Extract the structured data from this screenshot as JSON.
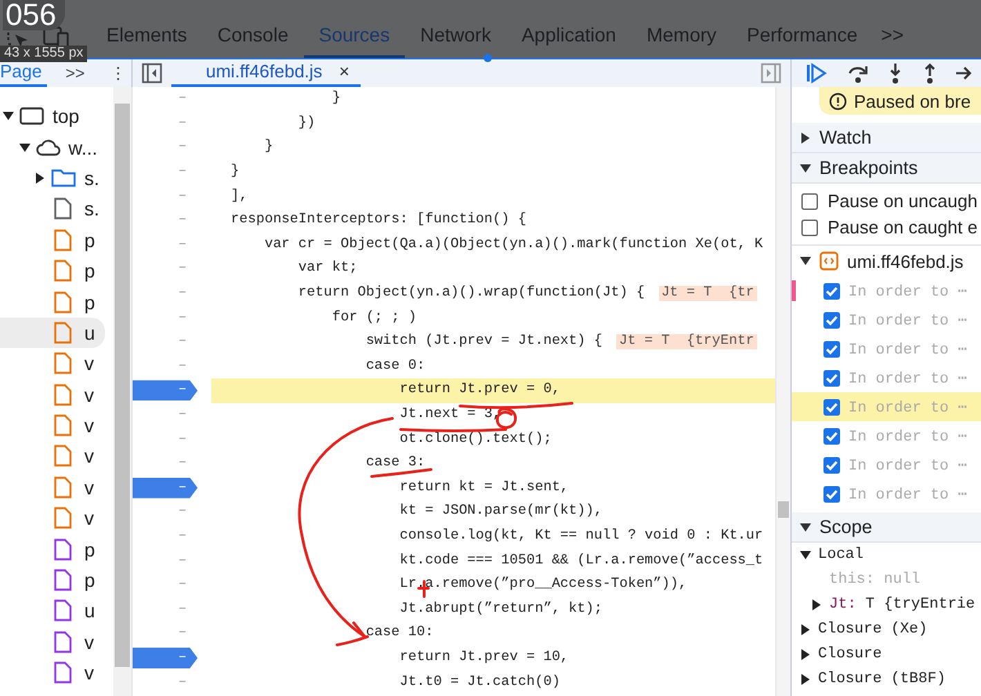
{
  "top_badge": "056",
  "dimension_tooltip": "43 x 1555 px",
  "panel_tabs": [
    {
      "label": "Elements",
      "selected": false
    },
    {
      "label": "Console",
      "selected": false
    },
    {
      "label": "Sources",
      "selected": true
    },
    {
      "label": "Network",
      "selected": false
    },
    {
      "label": "Application",
      "selected": false
    },
    {
      "label": "Memory",
      "selected": false
    },
    {
      "label": "Performance",
      "selected": false
    }
  ],
  "more_tabs": ">>",
  "navigator": {
    "tab": "Page",
    "more": ">>",
    "menu": "⋮"
  },
  "file_tree": [
    {
      "label": "top",
      "kind": "frame",
      "expanded": true,
      "selected": false,
      "children": [
        {
          "label": "w...",
          "kind": "cloud",
          "expanded": true,
          "selected": false,
          "children": [
            {
              "label": "s.",
              "kind": "folder",
              "expanded": false,
              "selected": false
            },
            {
              "label": "s.",
              "kind": "file",
              "color": "#5f6368",
              "selected": false
            },
            {
              "label": "p",
              "kind": "file",
              "color": "#e8710a",
              "selected": false
            },
            {
              "label": "p",
              "kind": "file",
              "color": "#e8710a",
              "selected": false
            },
            {
              "label": "p",
              "kind": "file",
              "color": "#e8710a",
              "selected": false
            },
            {
              "label": "u",
              "kind": "file",
              "color": "#e8710a",
              "selected": true
            },
            {
              "label": "v",
              "kind": "file",
              "color": "#e8710a",
              "selected": false
            },
            {
              "label": "v",
              "kind": "file",
              "color": "#e8710a",
              "selected": false
            },
            {
              "label": "v",
              "kind": "file",
              "color": "#e8710a",
              "selected": false
            },
            {
              "label": "v",
              "kind": "file",
              "color": "#e8710a",
              "selected": false
            },
            {
              "label": "v",
              "kind": "file",
              "color": "#e8710a",
              "selected": false
            },
            {
              "label": "v",
              "kind": "file",
              "color": "#e8710a",
              "selected": false
            },
            {
              "label": "p",
              "kind": "file",
              "color": "#9334e6",
              "selected": false
            },
            {
              "label": "p",
              "kind": "file",
              "color": "#9334e6",
              "selected": false
            },
            {
              "label": "u",
              "kind": "file",
              "color": "#9334e6",
              "selected": false
            },
            {
              "label": "v",
              "kind": "file",
              "color": "#9334e6",
              "selected": false
            },
            {
              "label": "v",
              "kind": "file",
              "color": "#9334e6",
              "selected": false
            }
          ]
        }
      ]
    }
  ],
  "editor": {
    "file_tab": {
      "label": "umi.ff46febd.js",
      "close": "×"
    },
    "lines": [
      {
        "number": "–",
        "breakpoint": false,
        "current": false,
        "code": "            }"
      },
      {
        "number": "–",
        "breakpoint": false,
        "current": false,
        "code": "        })"
      },
      {
        "number": "–",
        "breakpoint": false,
        "current": false,
        "code": "    }"
      },
      {
        "number": "–",
        "breakpoint": false,
        "current": false,
        "code": "}"
      },
      {
        "number": "–",
        "breakpoint": false,
        "current": false,
        "code": "],"
      },
      {
        "number": "–",
        "breakpoint": false,
        "current": false,
        "code": "responseInterceptors: [function() {"
      },
      {
        "number": "–",
        "breakpoint": false,
        "current": false,
        "code": "    var cr = Object(Qa.a)(Object(yn.a)().mark(function Xe(ot, K"
      },
      {
        "number": "–",
        "breakpoint": false,
        "current": false,
        "code": "        var kt;"
      },
      {
        "number": "–",
        "breakpoint": false,
        "current": false,
        "code": "        return Object(yn.a)().wrap(function(Jt) {",
        "inline_value": "Jt = T  {tr"
      },
      {
        "number": "–",
        "breakpoint": false,
        "current": false,
        "code": "            for (; ; )"
      },
      {
        "number": "–",
        "breakpoint": false,
        "current": false,
        "code": "                switch (Jt.prev = Jt.next) {",
        "inline_value": "Jt = T  {tryEntr"
      },
      {
        "number": "–",
        "breakpoint": false,
        "current": false,
        "code": "                case 0:"
      },
      {
        "number": "–",
        "breakpoint": true,
        "current": true,
        "code": "                    return Jt.prev = 0,"
      },
      {
        "number": "–",
        "breakpoint": false,
        "current": false,
        "code": "                    Jt.next = 3,"
      },
      {
        "number": "–",
        "breakpoint": false,
        "current": false,
        "code": "                    ot.clone().text();"
      },
      {
        "number": "–",
        "breakpoint": false,
        "current": false,
        "code": "                case 3:"
      },
      {
        "number": "–",
        "breakpoint": true,
        "current": false,
        "code": "                    return kt = Jt.sent,"
      },
      {
        "number": "–",
        "breakpoint": false,
        "current": false,
        "code": "                    kt = JSON.parse(mr(kt)),"
      },
      {
        "number": "–",
        "breakpoint": false,
        "current": false,
        "code": "                    console.log(kt, Kt == null ? void 0 : Kt.ur"
      },
      {
        "number": "–",
        "breakpoint": false,
        "current": false,
        "code": "                    kt.code === 10501 && (Lr.a.remove(”access_t"
      },
      {
        "number": "–",
        "breakpoint": false,
        "current": false,
        "code": "                    Lr.a.remove(”pro__Access-Token”)),"
      },
      {
        "number": "–",
        "breakpoint": false,
        "current": false,
        "code": "                    Jt.abrupt(”return”, kt);"
      },
      {
        "number": "–",
        "breakpoint": false,
        "current": false,
        "code": "                case 10:"
      },
      {
        "number": "–",
        "breakpoint": true,
        "current": false,
        "code": "                    return Jt.prev = 10,"
      },
      {
        "number": "–",
        "breakpoint": false,
        "current": false,
        "code": "                    Jt.t0 = Jt.catch(0)"
      }
    ]
  },
  "debugger": {
    "paused_message": "Paused on bre",
    "watch": {
      "title": "Watch",
      "expanded": false
    },
    "breakpoints": {
      "title": "Breakpoints",
      "expanded": true,
      "options": [
        {
          "label": "Pause on uncaugh",
          "checked": false
        },
        {
          "label": "Pause on caught e",
          "checked": false
        }
      ],
      "file": {
        "label": "umi.ff46febd.js",
        "expanded": true
      },
      "items": [
        {
          "label": "In order to ⋯",
          "checked": true,
          "selected": false,
          "flagged": true
        },
        {
          "label": "In order to ⋯",
          "checked": true,
          "selected": false,
          "flagged": false
        },
        {
          "label": "In order to ⋯",
          "checked": true,
          "selected": false,
          "flagged": false
        },
        {
          "label": "In order to ⋯",
          "checked": true,
          "selected": false,
          "flagged": false
        },
        {
          "label": "In order to ⋯",
          "checked": true,
          "selected": true,
          "flagged": false
        },
        {
          "label": "In order to ⋯",
          "checked": true,
          "selected": false,
          "flagged": false
        },
        {
          "label": "In order to ⋯",
          "checked": true,
          "selected": false,
          "flagged": false
        },
        {
          "label": "In order to ⋯",
          "checked": true,
          "selected": false,
          "flagged": false
        }
      ]
    },
    "scope": {
      "title": "Scope",
      "expanded": true,
      "items": [
        {
          "label": "Local",
          "expanded": true,
          "children": [
            {
              "kind": "internal",
              "name": "this:",
              "value": "null"
            },
            {
              "kind": "own",
              "name": "Jt:",
              "value": "T  {tryEntrie",
              "expanded": false
            }
          ]
        },
        {
          "label": "Closure (Xe)",
          "expanded": false
        },
        {
          "label": "Closure",
          "expanded": false
        },
        {
          "label": "Closure (tB8F)",
          "expanded": false
        }
      ]
    }
  }
}
